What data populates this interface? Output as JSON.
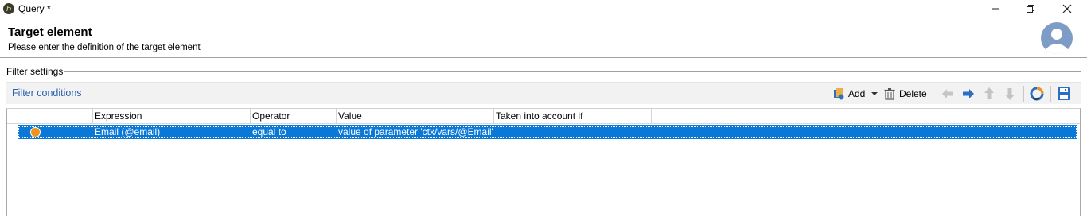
{
  "window": {
    "title": "Query *",
    "app_icon_glyph": "Þ"
  },
  "header": {
    "title": "Target element",
    "subtitle": "Please enter the definition of the target element"
  },
  "filter_settings": {
    "group_label": "Filter settings",
    "toolbar": {
      "title": "Filter conditions",
      "add_label": "Add",
      "delete_label": "Delete"
    },
    "grid": {
      "columns": [
        "Expression",
        "Operator",
        "Value",
        "Taken into account if"
      ],
      "rows": [
        {
          "status_icon": "orange-dot-icon",
          "expression": "Email (@email)",
          "operator": "equal to",
          "value": "value of parameter 'ctx/vars/@Email'",
          "taken_into_account_if": "",
          "selected": true
        }
      ]
    }
  },
  "colors": {
    "accent": "#2a62b0",
    "selection": "#0a78d7",
    "status_dot": "#f0931e",
    "avatar": "#7f9cc6"
  }
}
